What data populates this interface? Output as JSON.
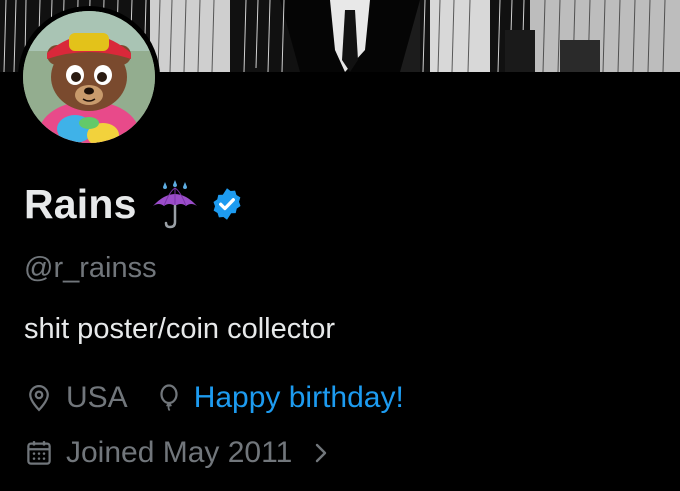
{
  "profile": {
    "display_name": "Rains",
    "name_emoji": "umbrella-with-rain-icon",
    "verified_badge": "verified-icon",
    "handle": "@r_rainss",
    "bio": "shit poster/coin collector",
    "location": "USA",
    "birthday_text": "Happy birthday!",
    "joined": "Joined May 2011"
  },
  "icons": {
    "location": "location-pin-icon",
    "birthday": "balloon-icon",
    "calendar": "calendar-icon",
    "chevron": "chevron-right-icon"
  },
  "colors": {
    "background": "#000000",
    "text_primary": "#e7e9ea",
    "text_secondary": "#71767b",
    "link": "#1d9bf0",
    "verified": "#1d9bf0",
    "umbrella": "#9b4dca"
  }
}
